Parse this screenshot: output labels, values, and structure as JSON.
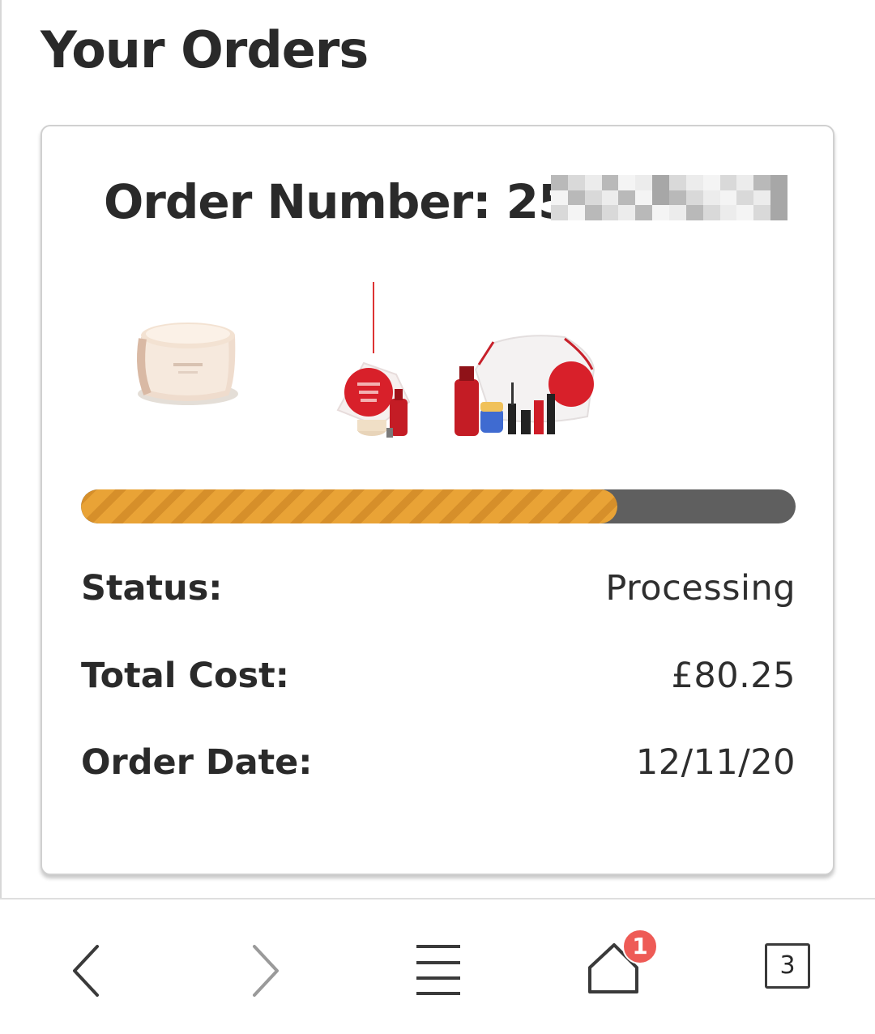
{
  "page": {
    "title": "Your Orders"
  },
  "order": {
    "number_label": "Order Number: 25",
    "progress_fraction": 0.75,
    "status_label": "Status:",
    "status_value": "Processing",
    "cost_label": "Total Cost:",
    "cost_value": "£80.25",
    "date_label": "Order Date:",
    "date_value": "12/11/20",
    "products": [
      {
        "icon": "cream-jar-image"
      },
      {
        "icon": "gift-set-image"
      },
      {
        "icon": "pouch-set-image"
      }
    ]
  },
  "nav": {
    "home_badge": "1",
    "tab_count": "3"
  },
  "colors": {
    "progress_fill": "#e9a336",
    "progress_track": "#5f5f5f",
    "badge": "#ee5b56",
    "product_red": "#d8202a"
  }
}
